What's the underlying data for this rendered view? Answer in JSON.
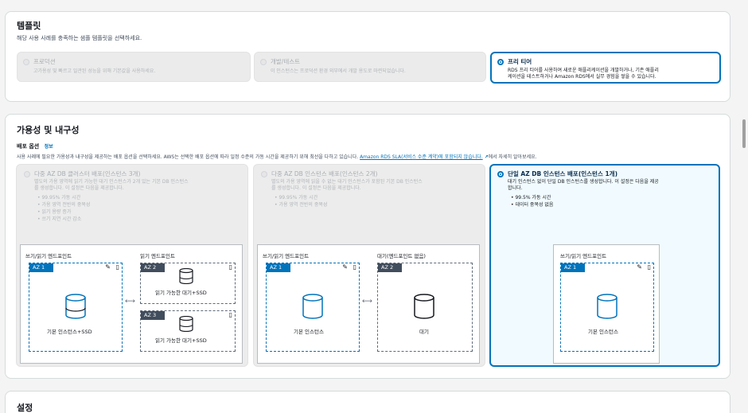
{
  "templates": {
    "title": "템플릿",
    "subtitle": "해당 사용 사례를 충족하는 샘플 템플릿을 선택하세요.",
    "options": [
      {
        "title": "프로덕션",
        "desc": "고가용성 및 빠르고 일관된 성능을 위해 기본값을 사용하세요."
      },
      {
        "title": "개발/테스트",
        "desc": "이 인스턴스는 프로덕션 환경 외부에서 개발 용도로 마련되었습니다."
      },
      {
        "title": "프리 티어",
        "desc1": "RDS 프리 티어를 사용하여 새로운 애플리케이션을 개발하거나, 기존 애플리",
        "desc2": "케이션을 테스트하거나 Amazon RDS에서 실무 경험을 쌓을 수 있습니다."
      }
    ]
  },
  "availability": {
    "title": "가용성 및 내구성",
    "deploy_label": "배포 옵션",
    "info": "정보",
    "desc_prefix": "사용 사례에 필요한 가용성과 내구성을 제공하는 배포 옵션을 선택하세요. AWS는 선택한 배포 옵션에 따라 일정 수준의 가동 시간을 제공하기 위해 최선을 다하고 있습니다.",
    "desc_link": "Amazon RDS SLA(서비스 수준 계약)에 포함되지 않습니다.",
    "desc_suffix": "에서 자세히 알아보세요.",
    "options": [
      {
        "title": "다중 AZ DB 클러스터 배포(인스턴스 3개)",
        "desc1": "별도의 가용 영역에 읽기 가능한 대기 인스턴스가 2개 있는 기본 DB 인스턴스",
        "desc2": "를 생성합니다. 이 설정은 다음을 제공합니다.",
        "bullets": [
          "99.95% 가동 시간",
          "가용 영역 전반의 중복성",
          "읽기 용량 증가",
          "쓰기 지연 시간 감소"
        ]
      },
      {
        "title": "다중 AZ DB 인스턴스 배포(인스턴스 2개)",
        "desc1": "별도의 가용 영역에 읽을 수 없는 대기 인스턴스가 포함된 기본 DB 인스턴스",
        "desc2": "를 생성합니다. 이 설정은 다음을 제공합니다.",
        "bullets": [
          "99.95% 가동 시간",
          "가용 영역 전반의 중복성"
        ]
      },
      {
        "title": "단일 AZ DB 인스턴스 배포(인스턴스 1개)",
        "desc1": "대기 인스턴스 없이 단일 DB 인스턴스를 생성합니다. 이 설정은 다음을 제공",
        "desc2": "합니다.",
        "bullets": [
          "99.5% 가동 시간",
          "데이터 중복성 없음"
        ]
      }
    ],
    "diagram": {
      "rw_endpoint": "쓰기/읽기 엔드포인트",
      "read_endpoint": "읽기 엔드포인트",
      "standby_no_endpoint": "대기(엔드포인트 없음)",
      "az1": "AZ 1",
      "az2": "AZ 2",
      "az3": "AZ 3",
      "primary_ssd": "기본 인스턴스+SSD",
      "readable_standby_ssd": "읽기 가능한 대기+SSD",
      "primary": "기본 인스턴스",
      "standby": "대기"
    }
  },
  "settings": {
    "title": "설정"
  }
}
